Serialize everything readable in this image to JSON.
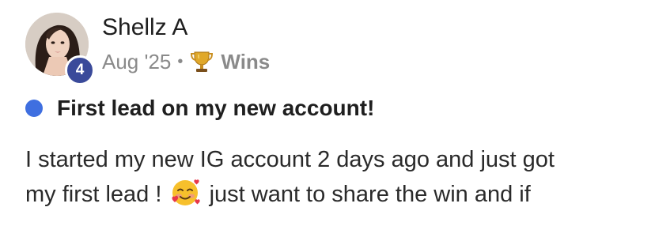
{
  "post": {
    "author": {
      "name": "Shellz A",
      "level": "4",
      "avatar_icon": "profile-photo"
    },
    "meta": {
      "date": "Aug '25",
      "separator": "•",
      "category_icon": "trophy-icon",
      "category": "Wins"
    },
    "title": "First lead on my new account!",
    "body": {
      "line1": "I started my new IG account 2 days ago and just got",
      "line2_before_emoji": "my first lead !",
      "emoji_icon": "smiling-face-with-hearts-emoji",
      "line2_after_emoji": "just want to share the win and if"
    }
  },
  "colors": {
    "unread_dot": "#3f6fe0",
    "level_badge": "#3a4a9a",
    "meta_text": "#8a8a8a",
    "trophy": "#d9a21f"
  }
}
